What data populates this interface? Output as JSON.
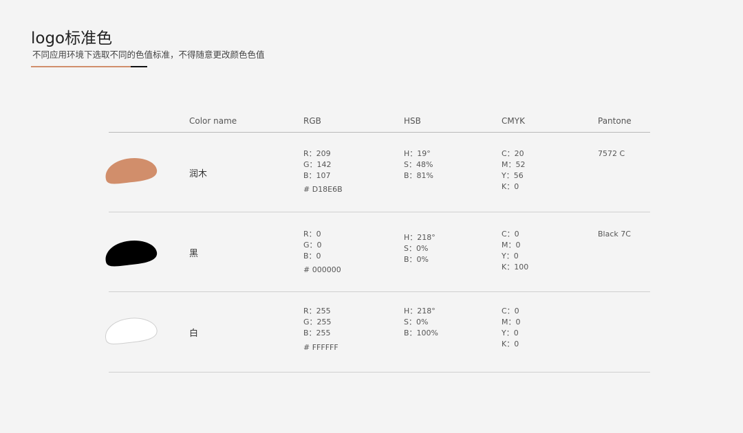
{
  "header": {
    "title": "logo标准色",
    "subtitle": "不同应用环境下选取不同的色值标准，不得随意更改颜色色值",
    "accent_color": "#D18E6B",
    "accent_dark": "#111111"
  },
  "table": {
    "columns": [
      "Color name",
      "RGB",
      "HSB",
      "CMYK",
      "Pantone"
    ],
    "rows": [
      {
        "name": "润木",
        "swatch_color": "#D18E6B",
        "rgb": [
          "R：209",
          "G：142",
          "B：107"
        ],
        "hex": "# D18E6B",
        "hsb": [
          "H：19°",
          "S：48%",
          "B：81%"
        ],
        "cmyk": [
          "C：20",
          "M：52",
          "Y：56",
          "K：0"
        ],
        "pantone": "7572 C"
      },
      {
        "name": "黑",
        "swatch_color": "#000000",
        "rgb": [
          "R：0",
          "G：0",
          "B：0"
        ],
        "hex": "# 000000",
        "hsb": [
          "H：218°",
          "S：0%",
          "B：0%"
        ],
        "cmyk": [
          "C：0",
          "M：0",
          "Y：0",
          "K：100"
        ],
        "pantone": "Black 7C"
      },
      {
        "name": "白",
        "swatch_color": "#FFFFFF",
        "rgb": [
          "R：255",
          "G：255",
          "B：255"
        ],
        "hex": "# FFFFFF",
        "hsb": [
          "H：218°",
          "S：0%",
          "B：100%"
        ],
        "cmyk": [
          "C：0",
          "M：0",
          "Y：0",
          "K：0"
        ],
        "pantone": ""
      }
    ]
  }
}
